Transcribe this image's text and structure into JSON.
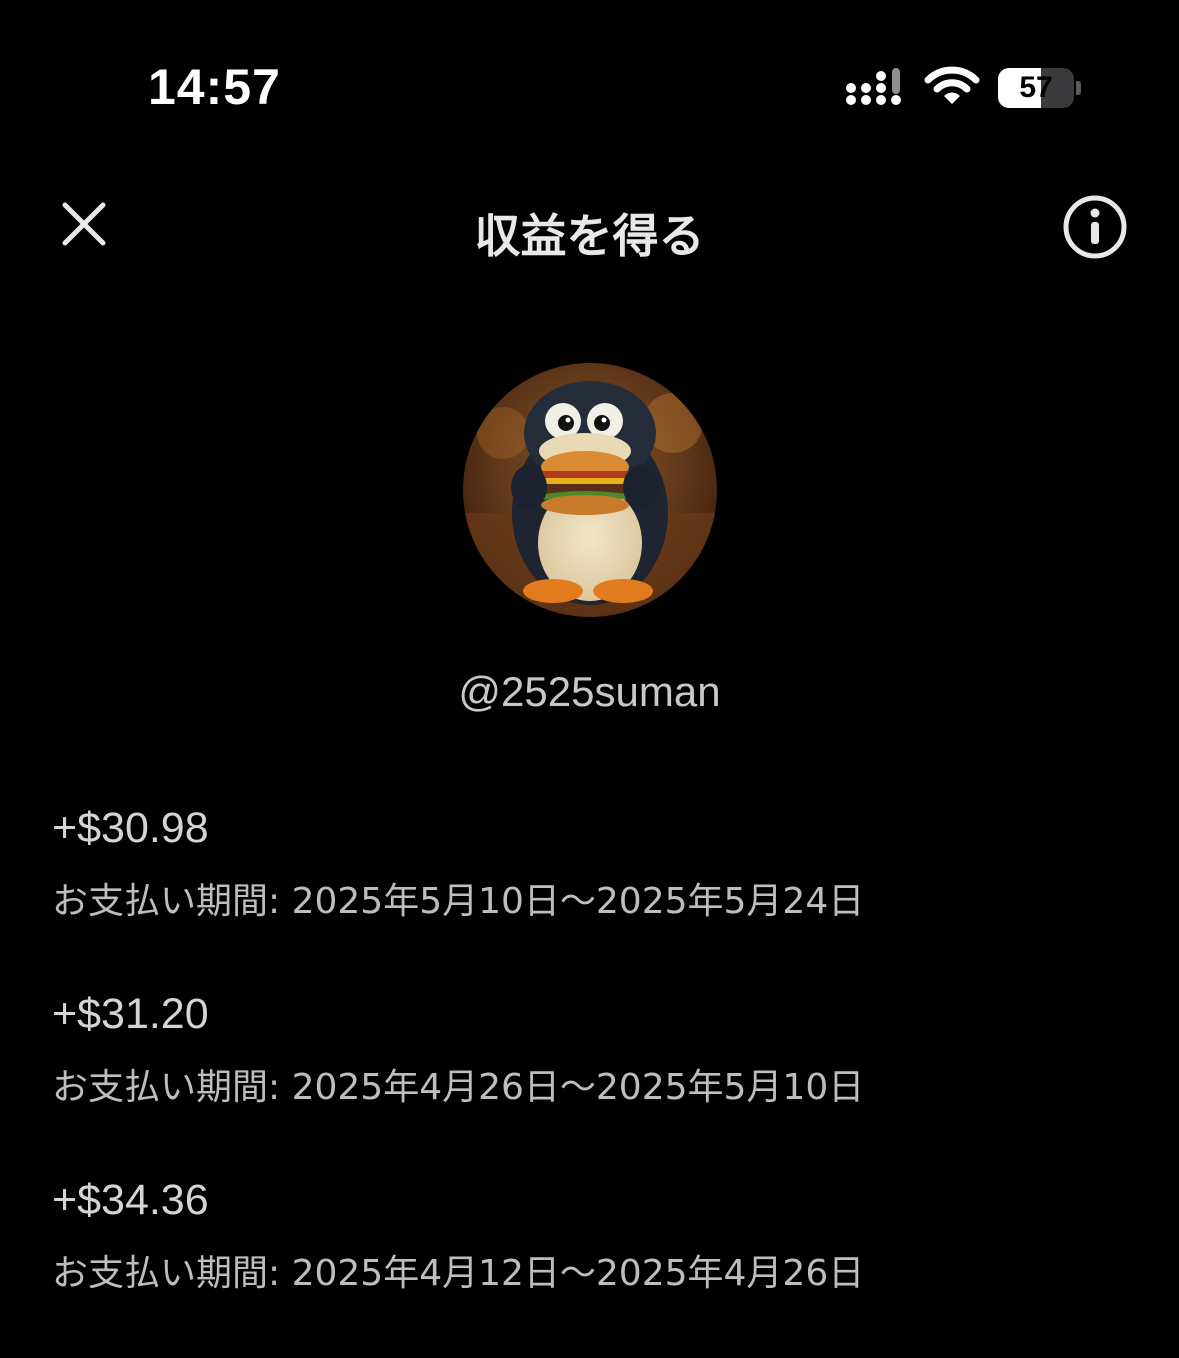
{
  "status_bar": {
    "time": "14:57",
    "battery_level": "57",
    "battery_fraction": 0.57,
    "icons": [
      "cellular-signal-icon",
      "wifi-icon",
      "battery-icon"
    ]
  },
  "header": {
    "title": "収益を得る",
    "close_icon": "close-icon",
    "info_icon": "info-icon"
  },
  "profile": {
    "username": "@2525suman",
    "avatar": "penguin-eating-burger"
  },
  "payouts": [
    {
      "amount": "+$30.98",
      "period": "お支払い期間: 2025年5月10日〜2025年5月24日"
    },
    {
      "amount": "+$31.20",
      "period": "お支払い期間: 2025年4月26日〜2025年5月10日"
    },
    {
      "amount": "+$34.36",
      "period": "お支払い期間: 2025年4月12日〜2025年4月26日"
    }
  ],
  "colors": {
    "background": "#000000",
    "text_primary": "#ffffff",
    "text_secondary": "#bdbdbd"
  }
}
